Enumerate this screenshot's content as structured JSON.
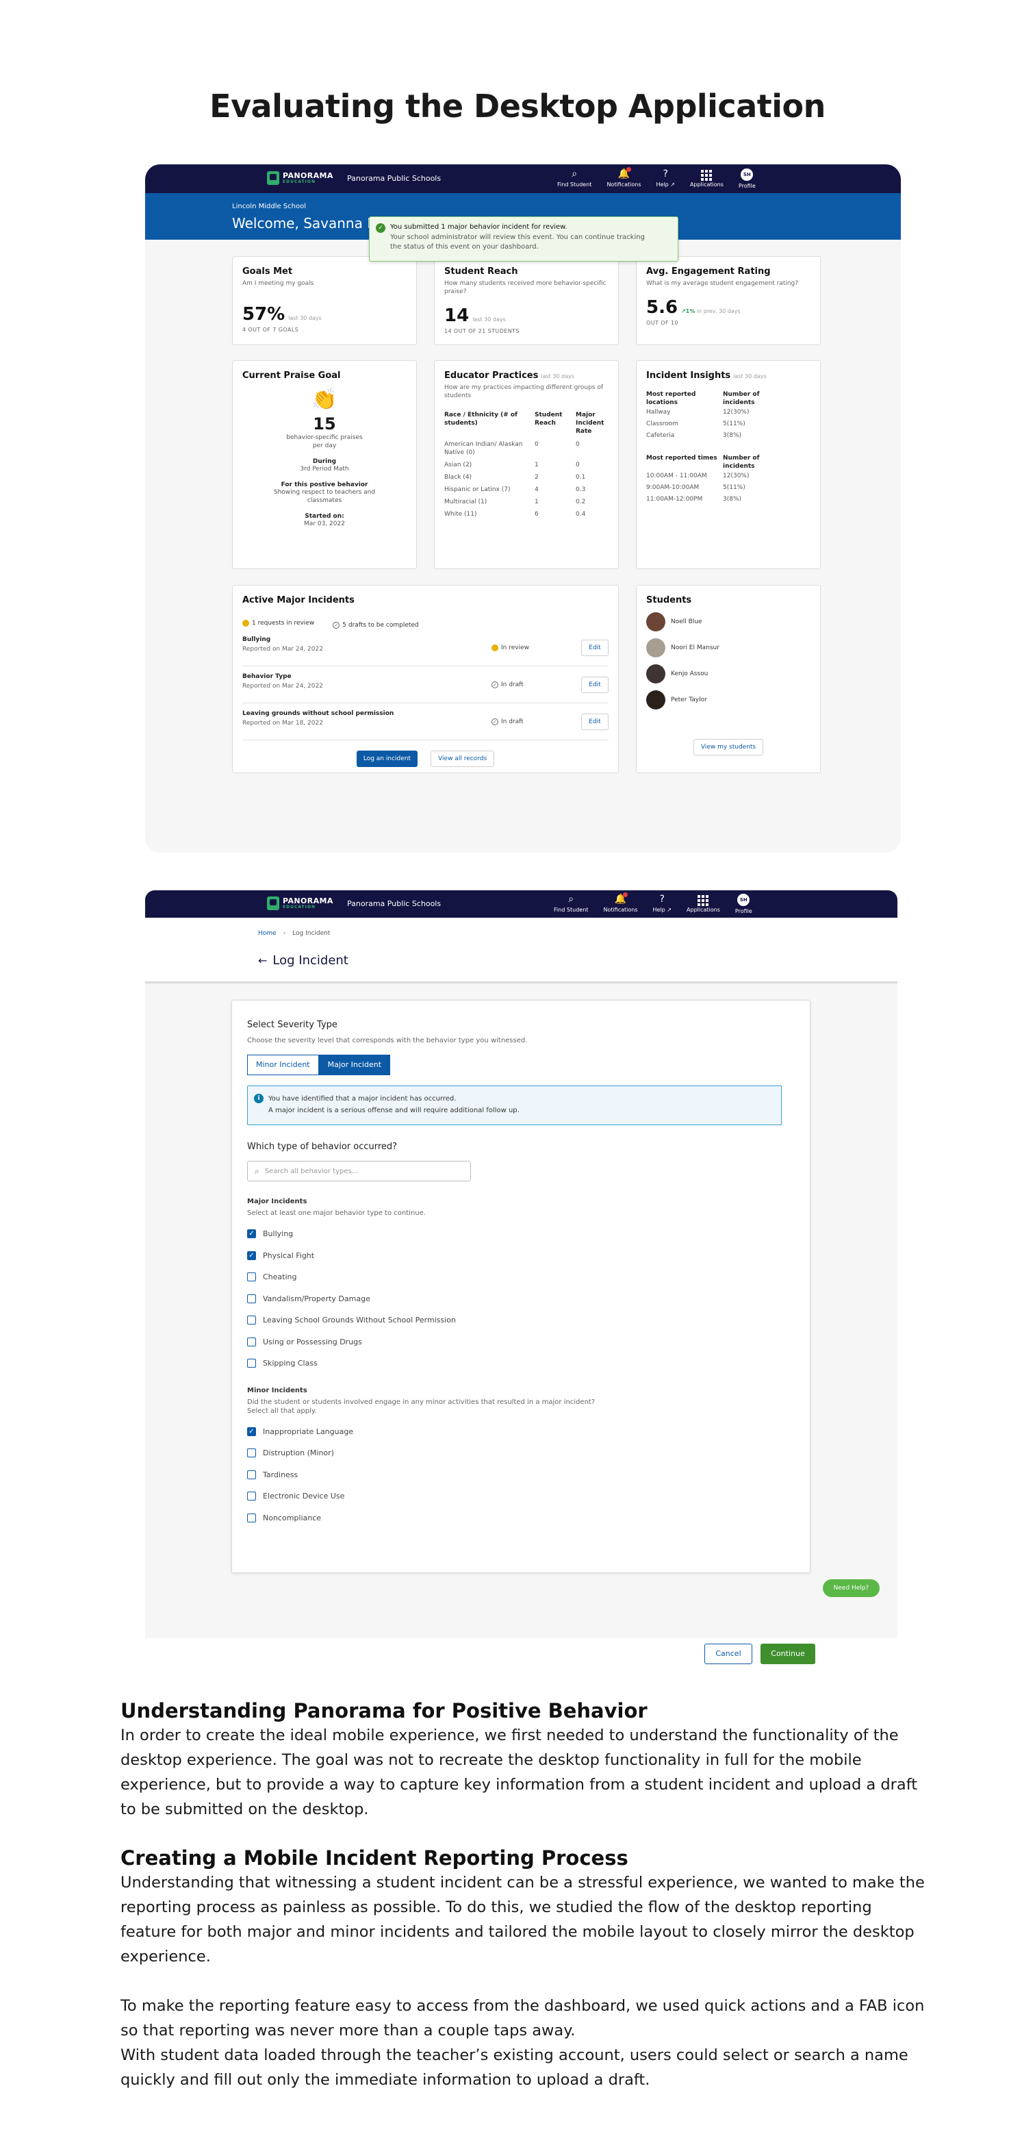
{
  "page": {
    "title": "Evaluating the Desktop Application"
  },
  "nav": {
    "brand": "PANORAMA",
    "brand_sub": "EDUCATION",
    "school": "Panorama Public Schools",
    "items": [
      {
        "label": "Find Student",
        "icon": "search-icon"
      },
      {
        "label": "Notifications",
        "icon": "bell-icon"
      },
      {
        "label": "Help",
        "icon": "help-icon"
      },
      {
        "label": "Applications",
        "icon": "grid-icon"
      },
      {
        "label": "Profile",
        "icon": "avatar",
        "initials": "SH"
      }
    ]
  },
  "dashboard": {
    "school": "Lincoln Middle School",
    "welcome": "Welcome, Savanna Ha",
    "toast": {
      "title": "You submitted 1 major behavior incident for review.",
      "body": "Your school administrator will review this event. You can continue tracking the status of this event on your dashboard."
    },
    "goals": {
      "title": "Goals Met",
      "sub": "Am I meeting my goals",
      "value": "57%",
      "period": "last 30 days",
      "detail": "4 OUT OF 7 GOALS"
    },
    "reach": {
      "title": "Student Reach",
      "sub": "How many students received more behavior-specific praise?",
      "value": "14",
      "period": "last 30 days",
      "detail": "14 OUT OF 21 STUDENTS"
    },
    "engagement": {
      "title": "Avg. Engagement Rating",
      "sub": "What is my average student engagement rating?",
      "value": "5.6",
      "trend": "↗1%",
      "trend_period": "in prev. 30 days",
      "detail": "OUT OF 10"
    },
    "praise": {
      "title": "Current Praise Goal",
      "value": "15",
      "unit_l1": "behavior-specific praises",
      "unit_l2": "per day",
      "during_label": "During",
      "during": "3rd Period Math",
      "behavior_label": "For this postive behavior",
      "behavior_l1": "Showing respect to teachers and",
      "behavior_l2": "classmates",
      "started_label": "Started on:",
      "started": "Mar 03, 2022"
    },
    "practices": {
      "title": "Educator Practices",
      "period": "last 30 days",
      "sub": "How are my practices impacting different groups of students",
      "headers": [
        "Race / Ethnicity (# of students)",
        "Student Reach",
        "Major Incident Rate"
      ],
      "rows": [
        [
          "American Indian/ Alaskan Native (0)",
          "0",
          "0"
        ],
        [
          "Asian (2)",
          "1",
          "0"
        ],
        [
          "Black (4)",
          "2",
          "0.1"
        ],
        [
          "Hispanic or Latinx (7)",
          "4",
          "0.3"
        ],
        [
          "Multiracial (1)",
          "1",
          "0.2"
        ],
        [
          "White (11)",
          "6",
          "0.4"
        ]
      ]
    },
    "insights": {
      "title": "Incident Insights",
      "period": "last 30 days",
      "loc_h1": "Most reported locations",
      "loc_h2": "Number of incidents",
      "locations": [
        [
          "Hallway",
          "12(30%)"
        ],
        [
          "Classroom",
          "5(11%)"
        ],
        [
          "Cafeteria",
          "3(8%)"
        ]
      ],
      "time_h1": "Most reported times",
      "time_h2": "Number of incidents",
      "times": [
        [
          "10:00AM - 11:00AM",
          "12(30%)"
        ],
        [
          "9:00AM-10:00AM",
          "5(11%)"
        ],
        [
          "11:00AM-12:00PM",
          "3(8%)"
        ]
      ]
    },
    "incidents": {
      "title": "Active Major Incidents",
      "review_chip": "1 requests in review",
      "draft_chip": "5 drafts to be completed",
      "rows": [
        {
          "name": "Bullying",
          "date": "Reported  on Mar 24, 2022",
          "status": "In review",
          "edit": "Edit"
        },
        {
          "name": "Behavior Type",
          "date": "Reported  on Mar 24, 2022",
          "status": "In draft",
          "edit": "Edit"
        },
        {
          "name": "Leaving grounds without school permission",
          "date": "Reported on Mar 18, 2022",
          "status": "In draft",
          "edit": "Edit"
        }
      ],
      "log_btn": "Log an incident",
      "all_btn": "View all records"
    },
    "students": {
      "title": "Students",
      "list": [
        {
          "name": "Noell Blue",
          "color": "#6b4636"
        },
        {
          "name": "Noori El Mansur",
          "color": "#a89d92"
        },
        {
          "name": "Kenjo Assou",
          "color": "#3e3431"
        },
        {
          "name": "Peter Taylor",
          "color": "#2a211d"
        }
      ],
      "view_btn": "View my students"
    }
  },
  "log": {
    "crumb_home": "Home",
    "crumb_sep": "›",
    "crumb_current": "Log Incident",
    "title": "Log Incident",
    "severity_h": "Select Severity Type",
    "severity_sub": "Choose the severity level that corresponds with the behavior type you witnessed.",
    "seg_minor": "Minor Incident",
    "seg_major": "Major Incident",
    "alert_title": "You have identified that a major incident has occurred.",
    "alert_body": "A major incident is a serious offense and will require additional follow up.",
    "which_h": "Which type of behavior occurred?",
    "search_placeholder": "Search all behavior types...",
    "major_h": "Major Incidents",
    "major_sub": "Select at least one major behavior type to continue.",
    "major_items": [
      {
        "label": "Bullying",
        "checked": true
      },
      {
        "label": "Physical Fight",
        "checked": true
      },
      {
        "label": "Cheating",
        "checked": false
      },
      {
        "label": "Vandalism/Property Damage",
        "checked": false
      },
      {
        "label": "Leaving School Grounds Without School Permission",
        "checked": false
      },
      {
        "label": "Using or Possessing Drugs",
        "checked": false
      },
      {
        "label": "Skipping Class",
        "checked": false
      }
    ],
    "minor_h": "Minor Incidents",
    "minor_sub1": "Did the student or students involved engage in any minor activities that resulted in a major incident?",
    "minor_sub2": "Select all that apply.",
    "minor_items": [
      {
        "label": "Inappropriate Language",
        "checked": true
      },
      {
        "label": "Distruption (Minor)",
        "checked": false
      },
      {
        "label": "Tardiness",
        "checked": false
      },
      {
        "label": "Electronic Device Use",
        "checked": false
      },
      {
        "label": "Noncompliance",
        "checked": false
      }
    ],
    "need_help": "Need Help?",
    "cancel": "Cancel",
    "continue": "Continue"
  },
  "sections": [
    {
      "heading": "Understanding Panorama for Positive Behavior",
      "paragraphs": [
        "In order to create the ideal mobile experience, we first needed to understand the functionality of the desktop experience. The goal was not to recreate the desktop functionality in full for the mobile experience, but to provide a way to capture key information from a student incident and upload a draft to be submitted on the desktop."
      ]
    },
    {
      "heading": "Creating a Mobile Incident Reporting Process",
      "paragraphs": [
        "Understanding that witnessing a student incident can be a stressful experience, we wanted to make the reporting process as painless as possible. To do this, we studied the flow of the desktop reporting feature for both major and minor incidents and tailored the mobile layout to closely mirror the desktop experience.",
        "To make the reporting feature easy to access from the dashboard, we used quick actions and a FAB icon so that reporting was never more than a couple taps away.",
        "With student data loaded through the teacher’s existing account, users could select or search a name quickly and fill out only the immediate information to upload a draft."
      ]
    }
  ]
}
